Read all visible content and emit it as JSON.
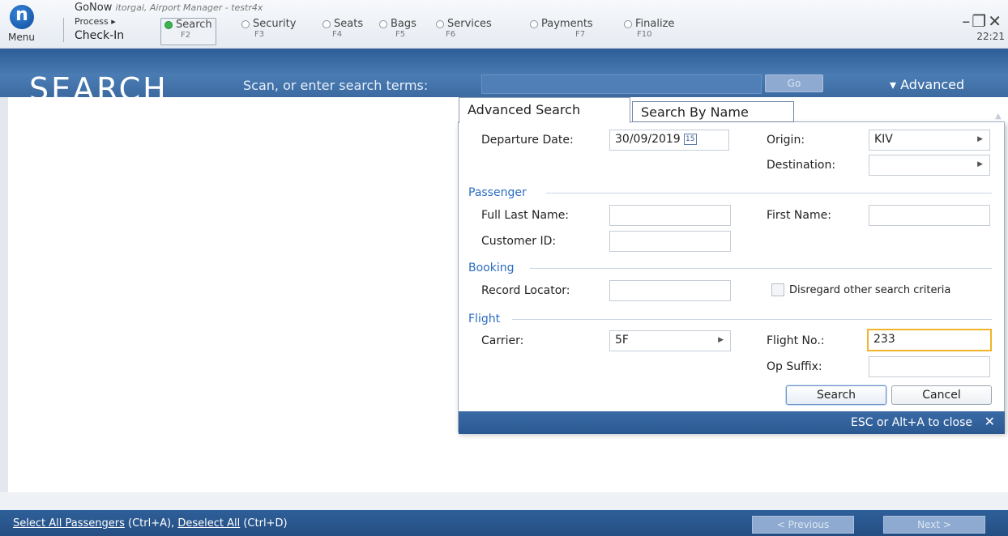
{
  "app": {
    "logo_glyph": "n",
    "menu": "Menu",
    "name": "GoNow",
    "user_info": "itorgai, Airport Manager - testr4x",
    "process": "Process ▸",
    "process_name": "Check-In",
    "clock": "22:21"
  },
  "steps": [
    {
      "label": "Search",
      "key": "F2",
      "active": true
    },
    {
      "label": "Security",
      "key": "F3"
    },
    {
      "label": "Seats",
      "key": "F4"
    },
    {
      "label": "Bags",
      "key": "F5"
    },
    {
      "label": "Services",
      "key": "F6"
    },
    {
      "label": "Payments",
      "key": "F7"
    },
    {
      "label": "Finalize",
      "key": "F10"
    }
  ],
  "search_band": {
    "title": "SEARCH",
    "prompt": "Scan, or enter search terms:",
    "input_value": "",
    "go_label": "Go",
    "advanced_label": "▾ Advanced"
  },
  "panel": {
    "tabs": [
      "Advanced Search",
      "Search By Name"
    ],
    "departure_date_label": "Departure Date:",
    "departure_date": "30/09/2019",
    "calendar_glyph": "15",
    "origin_label": "Origin:",
    "origin_value": "KIV",
    "destination_label": "Destination:",
    "destination_value": "",
    "passenger_section": "Passenger",
    "full_last_name_label": "Full Last Name:",
    "first_name_label": "First Name:",
    "customer_id_label": "Customer ID:",
    "booking_section": "Booking",
    "record_locator_label": "Record Locator:",
    "disregard_label": "Disregard other search criteria",
    "flight_section": "Flight",
    "carrier_label": "Carrier:",
    "carrier_value": "5F",
    "flight_no_label": "Flight No.:",
    "flight_no_value": "233",
    "op_suffix_label": "Op Suffix:",
    "search_btn": "Search",
    "cancel_btn": "Cancel",
    "close_hint": "ESC or Alt+A to close",
    "close_glyph": "✕"
  },
  "footer": {
    "select_all": "Select All Passengers",
    "select_all_key": " (Ctrl+A), ",
    "deselect_all": "Deselect All",
    "deselect_all_key": " (Ctrl+D)",
    "previous": "< Previous",
    "next": "Next >"
  },
  "colors": {
    "band": "#3c6aa1",
    "accent_blue": "#2a6cc2",
    "focus": "#f0b429",
    "active_dot": "#39b54a"
  }
}
